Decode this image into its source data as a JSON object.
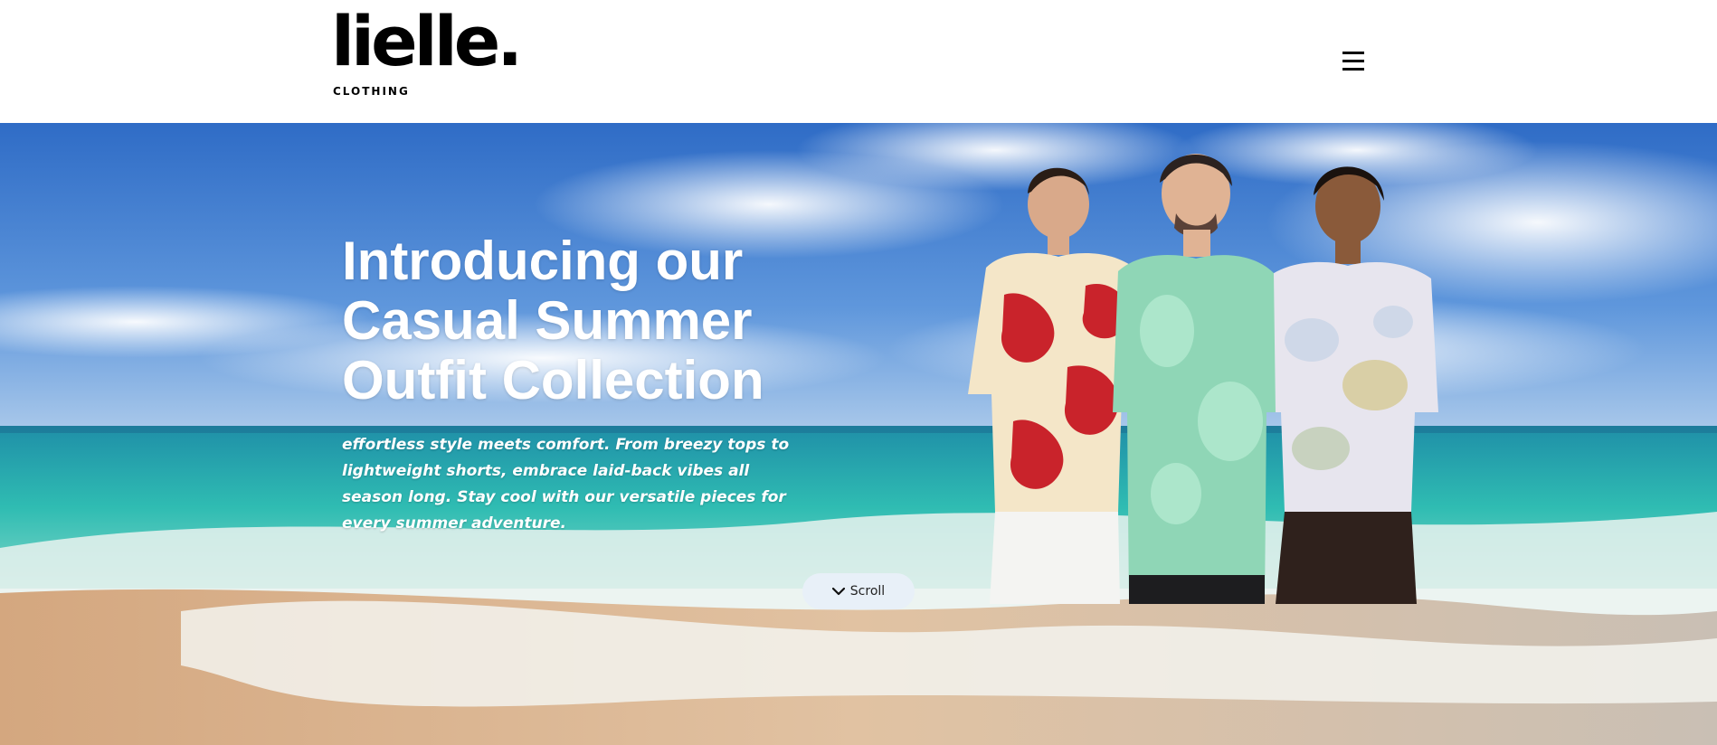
{
  "brand": {
    "name": "lielle.",
    "sub": "CLOTHING"
  },
  "nav": {
    "menu_icon": "hamburger-menu-icon"
  },
  "hero": {
    "title": "Introducing our Casual Summer Outfit Collection",
    "description": "effortless style meets comfort. From breezy tops to lightweight shorts, embrace laid-back vibes all season long. Stay cool with our versatile pieces for every summer adventure.",
    "background": "beach-ocean-sky-photo",
    "models_image": "three-models-in-summer-shirts-photo"
  },
  "scroll": {
    "label": "Scroll",
    "icon": "chevron-down-icon"
  },
  "colors": {
    "sky": "#3f7fd1",
    "sea": "#2fb5ae",
    "sand": "#d9b28a",
    "button_bg": "#e8f0f8"
  }
}
